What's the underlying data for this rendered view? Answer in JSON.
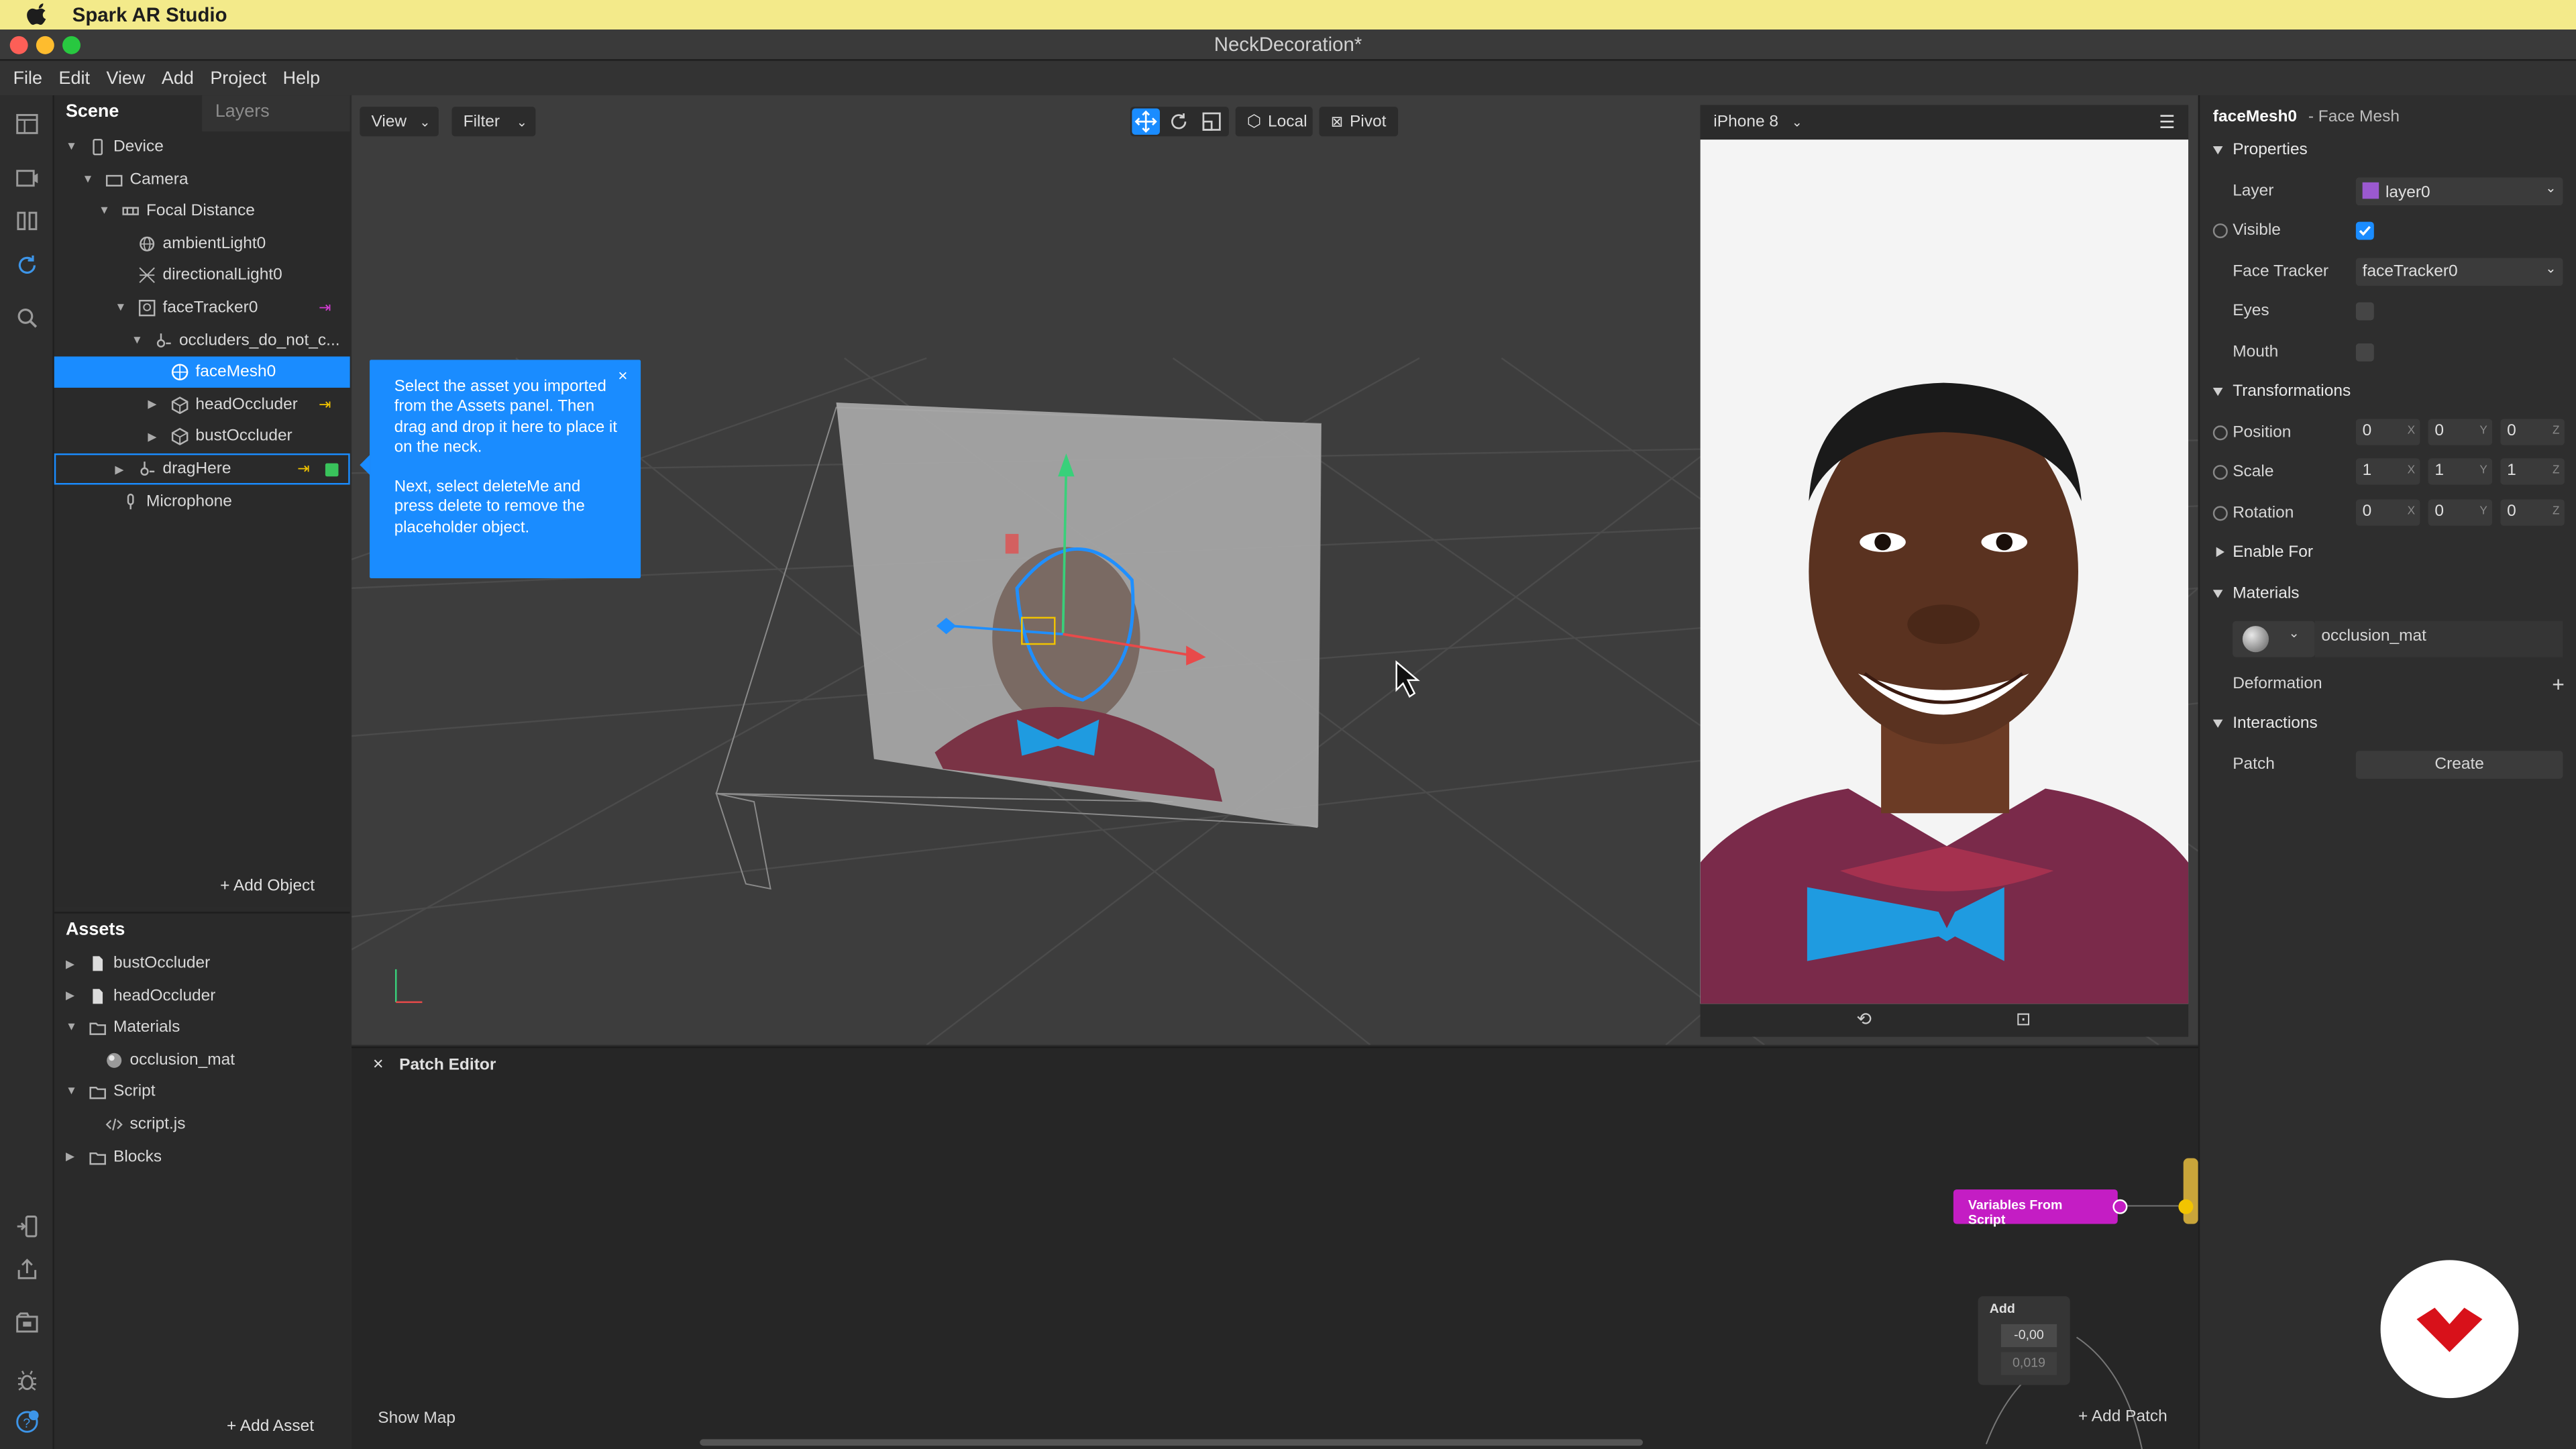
{
  "mac_menubar": {
    "app_name": "Spark AR Studio"
  },
  "window": {
    "title": "NeckDecoration*"
  },
  "app_menu": [
    "File",
    "Edit",
    "View",
    "Add",
    "Project",
    "Help"
  ],
  "scene_panel": {
    "tabs": [
      "Scene",
      "Layers"
    ],
    "tree": [
      {
        "label": "Device",
        "icon": "device-icon",
        "indent": 0,
        "arrow": "down"
      },
      {
        "label": "Camera",
        "icon": "camera-icon",
        "indent": 1,
        "arrow": "down"
      },
      {
        "label": "Focal Distance",
        "icon": "focal-distance-icon",
        "indent": 2,
        "arrow": "down"
      },
      {
        "label": "ambientLight0",
        "icon": "ambient-light-icon",
        "indent": 3,
        "arrow": ""
      },
      {
        "label": "directionalLight0",
        "icon": "directional-light-icon",
        "indent": 3,
        "arrow": ""
      },
      {
        "label": "faceTracker0",
        "icon": "face-tracker-icon",
        "indent": 3,
        "arrow": "down",
        "badge": "magenta"
      },
      {
        "label": "occluders_do_not_c...",
        "icon": "null-object-icon",
        "indent": 4,
        "arrow": "down"
      },
      {
        "label": "faceMesh0",
        "icon": "face-mesh-icon",
        "indent": 5,
        "arrow": "",
        "selected": true
      },
      {
        "label": "headOccluder",
        "icon": "mesh-object-icon",
        "indent": 5,
        "arrow": "right",
        "badge": "yellow"
      },
      {
        "label": "bustOccluder",
        "icon": "mesh-object-icon",
        "indent": 5,
        "arrow": "right"
      },
      {
        "label": "dragHere",
        "icon": "null-object-icon",
        "indent": 3,
        "arrow": "right",
        "badge": "yellow-green",
        "outlined": true
      },
      {
        "label": "Microphone",
        "icon": "microphone-icon",
        "indent": 2,
        "arrow": ""
      }
    ],
    "add_object_label": "Add Object"
  },
  "assets_panel": {
    "title": "Assets",
    "items": [
      {
        "label": "bustOccluder",
        "icon": "file-icon",
        "indent": 0,
        "arrow": "right"
      },
      {
        "label": "headOccluder",
        "icon": "file-icon",
        "indent": 0,
        "arrow": "right"
      },
      {
        "label": "Materials",
        "icon": "folder-icon",
        "indent": 0,
        "arrow": "down"
      },
      {
        "label": "occlusion_mat",
        "icon": "material-sphere-icon",
        "indent": 1,
        "arrow": ""
      },
      {
        "label": "Script",
        "icon": "folder-icon",
        "indent": 0,
        "arrow": "down"
      },
      {
        "label": "script.js",
        "icon": "code-icon",
        "indent": 1,
        "arrow": ""
      },
      {
        "label": "Blocks",
        "icon": "folder-icon",
        "indent": 0,
        "arrow": "right"
      }
    ],
    "add_asset_label": "Add Asset"
  },
  "viewport": {
    "view_label": "View",
    "filter_label": "Filter",
    "local_label": "Local",
    "pivot_label": "Pivot"
  },
  "tooltip": {
    "para1": "Select the asset you imported from the Assets panel. Then drag and drop it here to place it on the neck.",
    "para2": "Next, select deleteMe and press delete to remove the placeholder object.",
    "close": "×"
  },
  "simulator": {
    "device": "iPhone 8"
  },
  "inspector": {
    "object_name": "faceMesh0",
    "object_type": "- Face Mesh",
    "properties_title": "Properties",
    "layer_label": "Layer",
    "layer_value": "layer0",
    "layer_color": "#9b59d0",
    "visible_label": "Visible",
    "visible_checked": true,
    "face_tracker_label": "Face Tracker",
    "face_tracker_value": "faceTracker0",
    "eyes_label": "Eyes",
    "eyes_checked": false,
    "mouth_label": "Mouth",
    "mouth_checked": false,
    "transformations_title": "Transformations",
    "position_label": "Position",
    "position": [
      "0",
      "0",
      "0"
    ],
    "scale_label": "Scale",
    "scale": [
      "1",
      "1",
      "1"
    ],
    "rotation_label": "Rotation",
    "rotation": [
      "0",
      "0",
      "0"
    ],
    "axes": [
      "X",
      "Y",
      "Z"
    ],
    "enable_for_title": "Enable For",
    "materials_title": "Materials",
    "material_value": "occlusion_mat",
    "deformation_label": "Deformation",
    "interactions_title": "Interactions",
    "patch_label": "Patch",
    "create_label": "Create"
  },
  "patch_editor": {
    "title": "Patch Editor",
    "close": "×",
    "show_map_label": "Show Map",
    "add_patch_label": "Add Patch",
    "variables_node_label": "Variables From Script",
    "add_node_title": "Add",
    "add_node_input1": "-0,00",
    "add_node_input2": "0,019"
  },
  "colors": {
    "accent": "#1a8cff",
    "patch_magenta": "#c41dc4",
    "bowtie_blue": "#1f9be0"
  }
}
